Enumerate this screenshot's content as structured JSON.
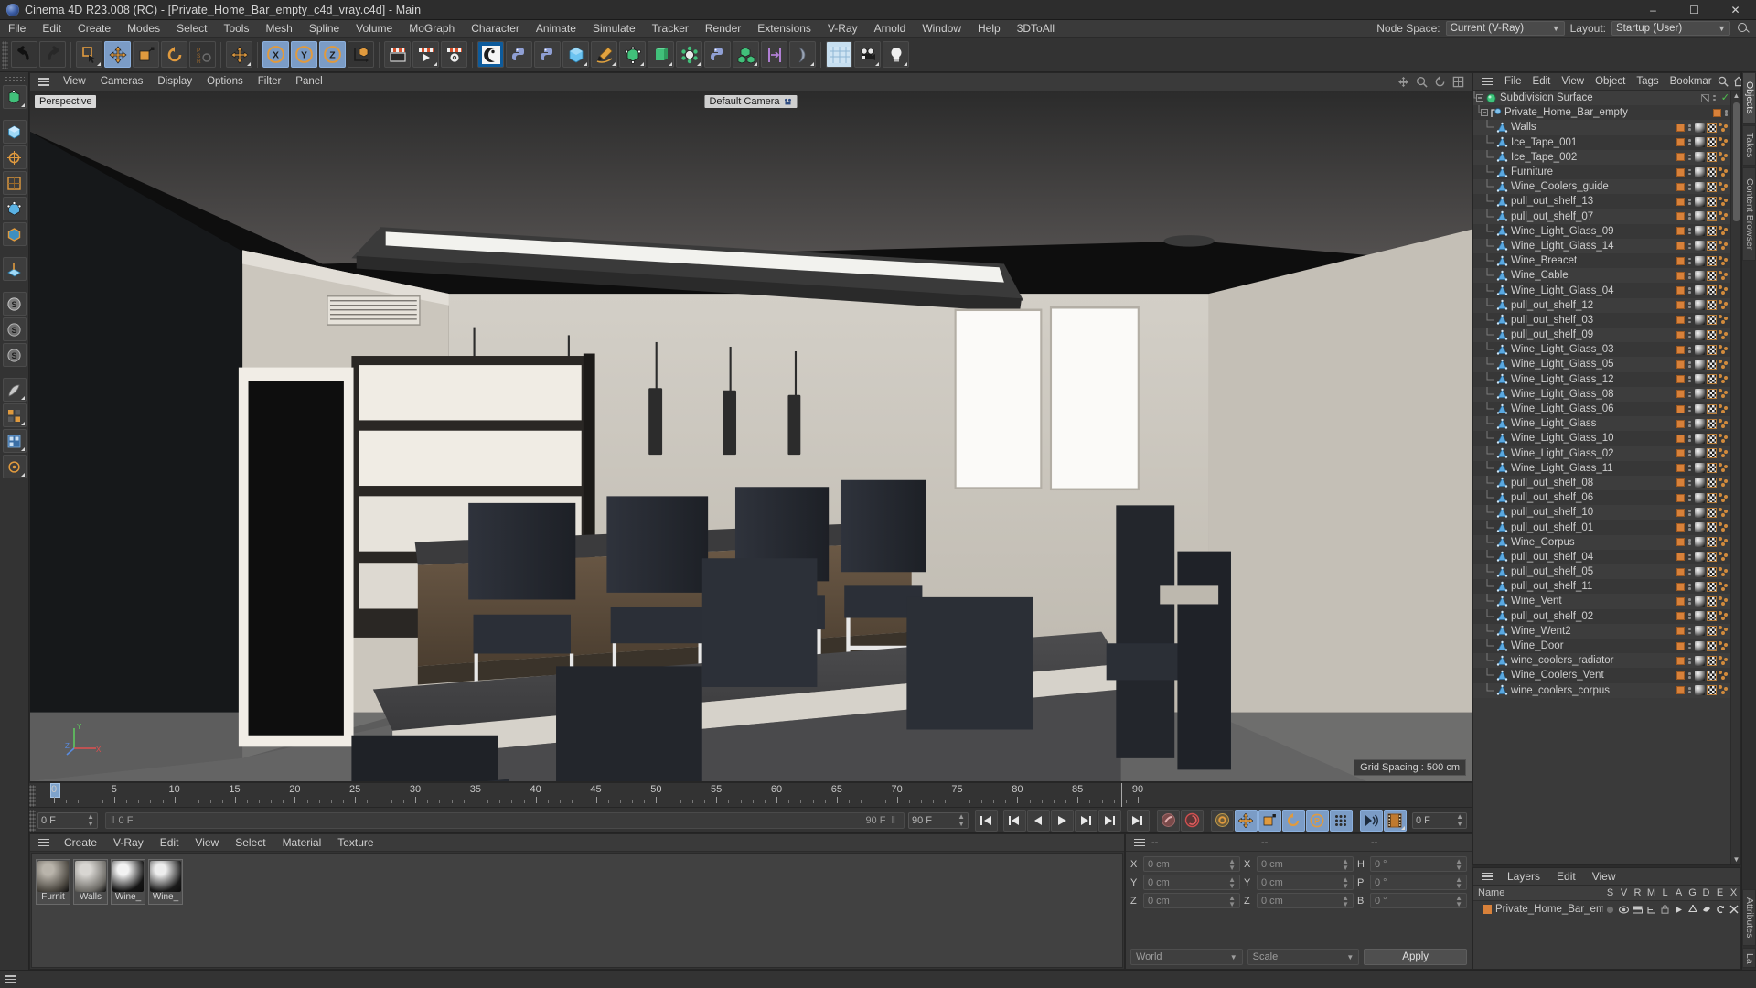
{
  "titlebar": {
    "title": "Cinema 4D R23.008 (RC) - [Private_Home_Bar_empty_c4d_vray.c4d] - Main",
    "minimize": "–",
    "maximize": "☐",
    "close": "✕"
  },
  "menubar": {
    "items": [
      "File",
      "Edit",
      "Create",
      "Modes",
      "Select",
      "Tools",
      "Mesh",
      "Spline",
      "Volume",
      "MoGraph",
      "Character",
      "Animate",
      "Simulate",
      "Tracker",
      "Render",
      "Extensions",
      "V-Ray",
      "Arnold",
      "Window",
      "Help",
      "3DToAll"
    ],
    "node_space_label": "Node Space:",
    "node_space_value": "Current (V-Ray)",
    "layout_label": "Layout:",
    "layout_value": "Startup (User)"
  },
  "viewport": {
    "menu": [
      "View",
      "Cameras",
      "Display",
      "Options",
      "Filter",
      "Panel"
    ],
    "label": "Perspective",
    "camera": "Default Camera",
    "grid_spacing": "Grid Spacing : 500 cm",
    "axis_x": "X",
    "axis_y": "Y",
    "axis_z": "Z"
  },
  "timeline": {
    "ticks": [
      0,
      5,
      10,
      15,
      20,
      25,
      30,
      35,
      40,
      45,
      50,
      55,
      60,
      65,
      70,
      75,
      80,
      85,
      90
    ],
    "current_frame": "0 F",
    "range_start": "0 F",
    "range_end": "90 F",
    "end_frame": "90 F",
    "frame_right": "0 F"
  },
  "material_manager": {
    "menu": [
      "Create",
      "V-Ray",
      "Edit",
      "View",
      "Select",
      "Material",
      "Texture"
    ],
    "materials": [
      {
        "name": "Furnit",
        "color1": "#b9b4ab",
        "color2": "#4a463f"
      },
      {
        "name": "Walls",
        "color1": "#d8d6d2",
        "color2": "#6d6b66"
      },
      {
        "name": "Wine_",
        "color1": "#f2f2f2",
        "color2": "#141414"
      },
      {
        "name": "Wine_",
        "color1": "#ededed",
        "color2": "#1a1a1a"
      }
    ]
  },
  "coordinates": {
    "header_dashes": [
      "--",
      "--",
      "--"
    ],
    "rows": [
      {
        "pos_label": "X",
        "pos_value": "0 cm",
        "size_label": "X",
        "size_value": "0 cm",
        "rot_label": "H",
        "rot_value": "0 °"
      },
      {
        "pos_label": "Y",
        "pos_value": "0 cm",
        "size_label": "Y",
        "size_value": "0 cm",
        "rot_label": "P",
        "rot_value": "0 °"
      },
      {
        "pos_label": "Z",
        "pos_value": "0 cm",
        "size_label": "Z",
        "size_value": "0 cm",
        "rot_label": "B",
        "rot_value": "0 °"
      }
    ],
    "world_select": "World",
    "scale_select": "Scale",
    "apply_button": "Apply"
  },
  "object_manager": {
    "menu": [
      "File",
      "Edit",
      "View",
      "Object",
      "Tags",
      "Bookmar"
    ],
    "root": {
      "name": "Subdivision Surface",
      "icon": "subdivision-surface-icon"
    },
    "group": {
      "name": "Private_Home_Bar_empty",
      "icon": "null-object-icon"
    },
    "objects": [
      "Walls",
      "Ice_Tape_001",
      "Ice_Tape_002",
      "Furniture",
      "Wine_Coolers_guide",
      "pull_out_shelf_13",
      "pull_out_shelf_07",
      "Wine_Light_Glass_09",
      "Wine_Light_Glass_14",
      "Wine_Breacet",
      "Wine_Cable",
      "Wine_Light_Glass_04",
      "pull_out_shelf_12",
      "pull_out_shelf_03",
      "pull_out_shelf_09",
      "Wine_Light_Glass_03",
      "Wine_Light_Glass_05",
      "Wine_Light_Glass_12",
      "Wine_Light_Glass_08",
      "Wine_Light_Glass_06",
      "Wine_Light_Glass",
      "Wine_Light_Glass_10",
      "Wine_Light_Glass_02",
      "Wine_Light_Glass_11",
      "pull_out_shelf_08",
      "pull_out_shelf_06",
      "pull_out_shelf_10",
      "pull_out_shelf_01",
      "Wine_Corpus",
      "pull_out_shelf_04",
      "pull_out_shelf_05",
      "pull_out_shelf_11",
      "Wine_Vent",
      "pull_out_shelf_02",
      "Wine_Went2",
      "Wine_Door",
      "wine_coolers_radiator",
      "Wine_Coolers_Vent",
      "wine_coolers_corpus"
    ]
  },
  "layer_manager": {
    "menu": [
      "Layers",
      "Edit",
      "View"
    ],
    "columns": [
      "Name",
      "S",
      "V",
      "R",
      "M",
      "L",
      "A",
      "G",
      "D",
      "E",
      "X"
    ],
    "rows": [
      {
        "name": "Private_Home_Bar_empty",
        "color": "#d8813a"
      }
    ]
  },
  "right_tabs": [
    {
      "label": "Objects",
      "active": true
    },
    {
      "label": "Takes",
      "active": false
    },
    {
      "label": "Content Browser",
      "active": false
    },
    {
      "label": "Attributes",
      "active": false
    },
    {
      "label": "La",
      "active": false
    }
  ],
  "statusbar": {
    "text": ""
  },
  "colors": {
    "accent_orange": "#d8813a",
    "accent_blue": "#7b9cc6",
    "panel_bg": "#333333",
    "list_bg": "#3a3a3a"
  }
}
